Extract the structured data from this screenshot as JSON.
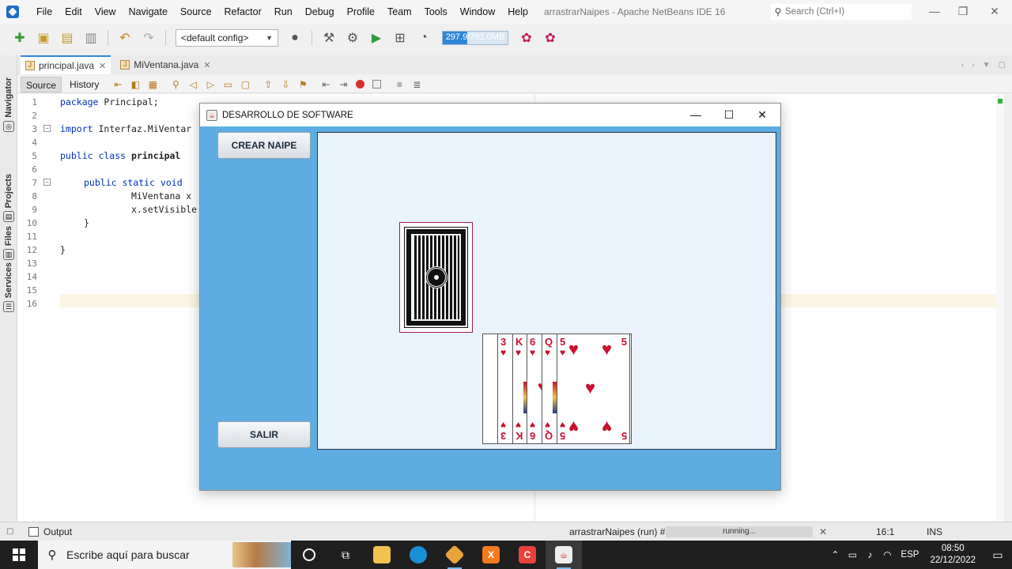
{
  "ide": {
    "title": "arrastrarNaipes - Apache NetBeans IDE 16",
    "menu": [
      "File",
      "Edit",
      "View",
      "Navigate",
      "Source",
      "Refactor",
      "Run",
      "Debug",
      "Profile",
      "Team",
      "Tools",
      "Window",
      "Help"
    ],
    "search_placeholder": "Search (Ctrl+I)",
    "config": "<default config>",
    "memory": {
      "label": "297.9/791.0MB",
      "fraction": 0.377
    }
  },
  "side_tabs": [
    "Navigator",
    "Projects",
    "Files",
    "Services"
  ],
  "editor_tabs": [
    {
      "label": "principal.java",
      "active": true
    },
    {
      "label": "MiVentana.java",
      "active": false
    }
  ],
  "editor_modes": {
    "source": "Source",
    "history": "History"
  },
  "code": {
    "line_numbers": [
      "1",
      "2",
      "3",
      "4",
      "5",
      "6",
      "7",
      "8",
      "9",
      "10",
      "11",
      "12",
      "13",
      "14",
      "15",
      "16"
    ],
    "l1_kw": "package",
    "l1_rest": " Principal;",
    "l3_kw": "import",
    "l3_rest": " Interfaz.MiVentar",
    "l5_kw": "public class",
    "l5_name": "principal",
    "l7_kw": "public static void",
    "l8": "MiVentana x",
    "l9": "x.setVisible",
    "l10": "}",
    "l12": "}"
  },
  "status": {
    "output": "Output",
    "run_label": "arrastrarNaipes (run) #2",
    "progress": "running...",
    "caret": "16:1",
    "mode": "INS"
  },
  "app_window": {
    "title": "DESARROLLO DE SOFTWARE",
    "create_button": "CREAR NAIPE",
    "exit_button": "SALIR",
    "colors": {
      "background": "#5dade2",
      "panel": "#eaf3fb",
      "card_red": "#c8102e"
    },
    "cards": [
      {
        "rank": "3",
        "suit": "♥"
      },
      {
        "rank": "K",
        "suit": "♥"
      },
      {
        "rank": "6",
        "suit": "♥"
      },
      {
        "rank": "Q",
        "suit": "♥"
      },
      {
        "rank": "5",
        "suit": "♥"
      }
    ]
  },
  "taskbar": {
    "search_placeholder": "Escribe aquí para buscar",
    "language": "ESP",
    "time": "08:50",
    "date": "22/12/2022"
  }
}
